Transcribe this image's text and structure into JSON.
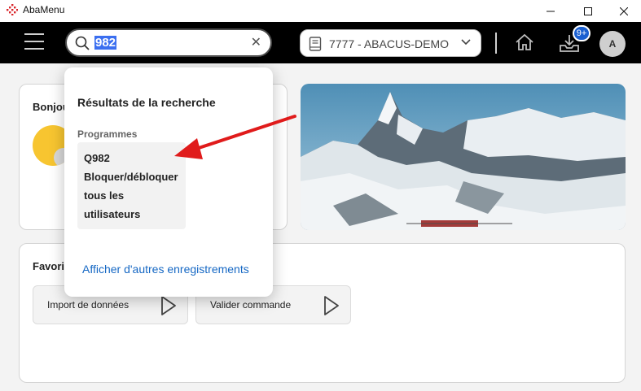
{
  "window": {
    "title": "AbaMenu"
  },
  "header": {
    "search": {
      "value": "982"
    },
    "company": {
      "label": "7777 - ABACUS-DEMO"
    },
    "notifications_badge": "9+",
    "avatar_initial": "A"
  },
  "greeting": {
    "title": "Bonjou"
  },
  "favorites": {
    "title": "Favori",
    "items": [
      {
        "label": "Import de données"
      },
      {
        "label": "Valider commande"
      }
    ]
  },
  "search_results": {
    "heading": "Résultats de la recherche",
    "section": "Programmes",
    "items": [
      {
        "lines": [
          "Q982",
          "Bloquer/débloquer",
          "tous les",
          "utilisateurs"
        ]
      }
    ],
    "more_link": "Afficher d'autres enregistrements"
  },
  "colors": {
    "accent": "#1668c4",
    "badge": "#1a5fd0",
    "annotation_arrow": "#e01b1b",
    "selection": "#3b6ff0"
  }
}
